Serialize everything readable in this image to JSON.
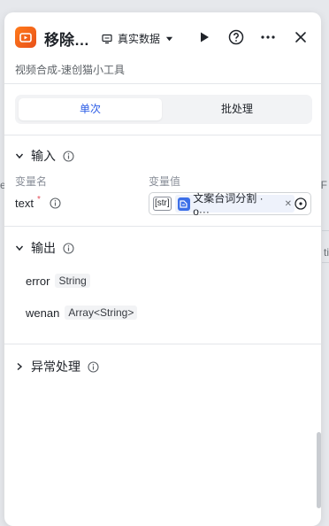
{
  "background": {
    "left_text": "e",
    "right_text_1": "F",
    "right_text_2": "ti"
  },
  "header": {
    "title": "移除…",
    "mode_label": "真实数据",
    "app_icon": "video-app-icon",
    "icons": {
      "mode": "device-icon",
      "mode_caret": "caret-down-icon",
      "play": "play-icon",
      "help": "help-circle-icon",
      "more": "more-horizontal-icon",
      "close": "close-icon"
    }
  },
  "subtitle": "视频合成-速创猫小工具",
  "tabs": [
    {
      "label": "单次",
      "active": true
    },
    {
      "label": "批处理",
      "active": false
    }
  ],
  "input_section": {
    "title": "输入",
    "col_name": "变量名",
    "col_value": "变量值",
    "variables": [
      {
        "name": "text",
        "required_mark": "*",
        "type_badge": "[str]",
        "ref_label": "文案台词分割 · o···",
        "ref_icon": "node-ref-icon"
      }
    ]
  },
  "output_section": {
    "title": "输出",
    "outputs": [
      {
        "name": "error",
        "type": "String"
      },
      {
        "name": "wenan",
        "type": "Array<String>"
      }
    ]
  },
  "exception_section": {
    "title": "异常处理"
  },
  "colors": {
    "accent": "#2b5ce6",
    "app_icon": "#f06a1f",
    "required": "#e34d59"
  }
}
